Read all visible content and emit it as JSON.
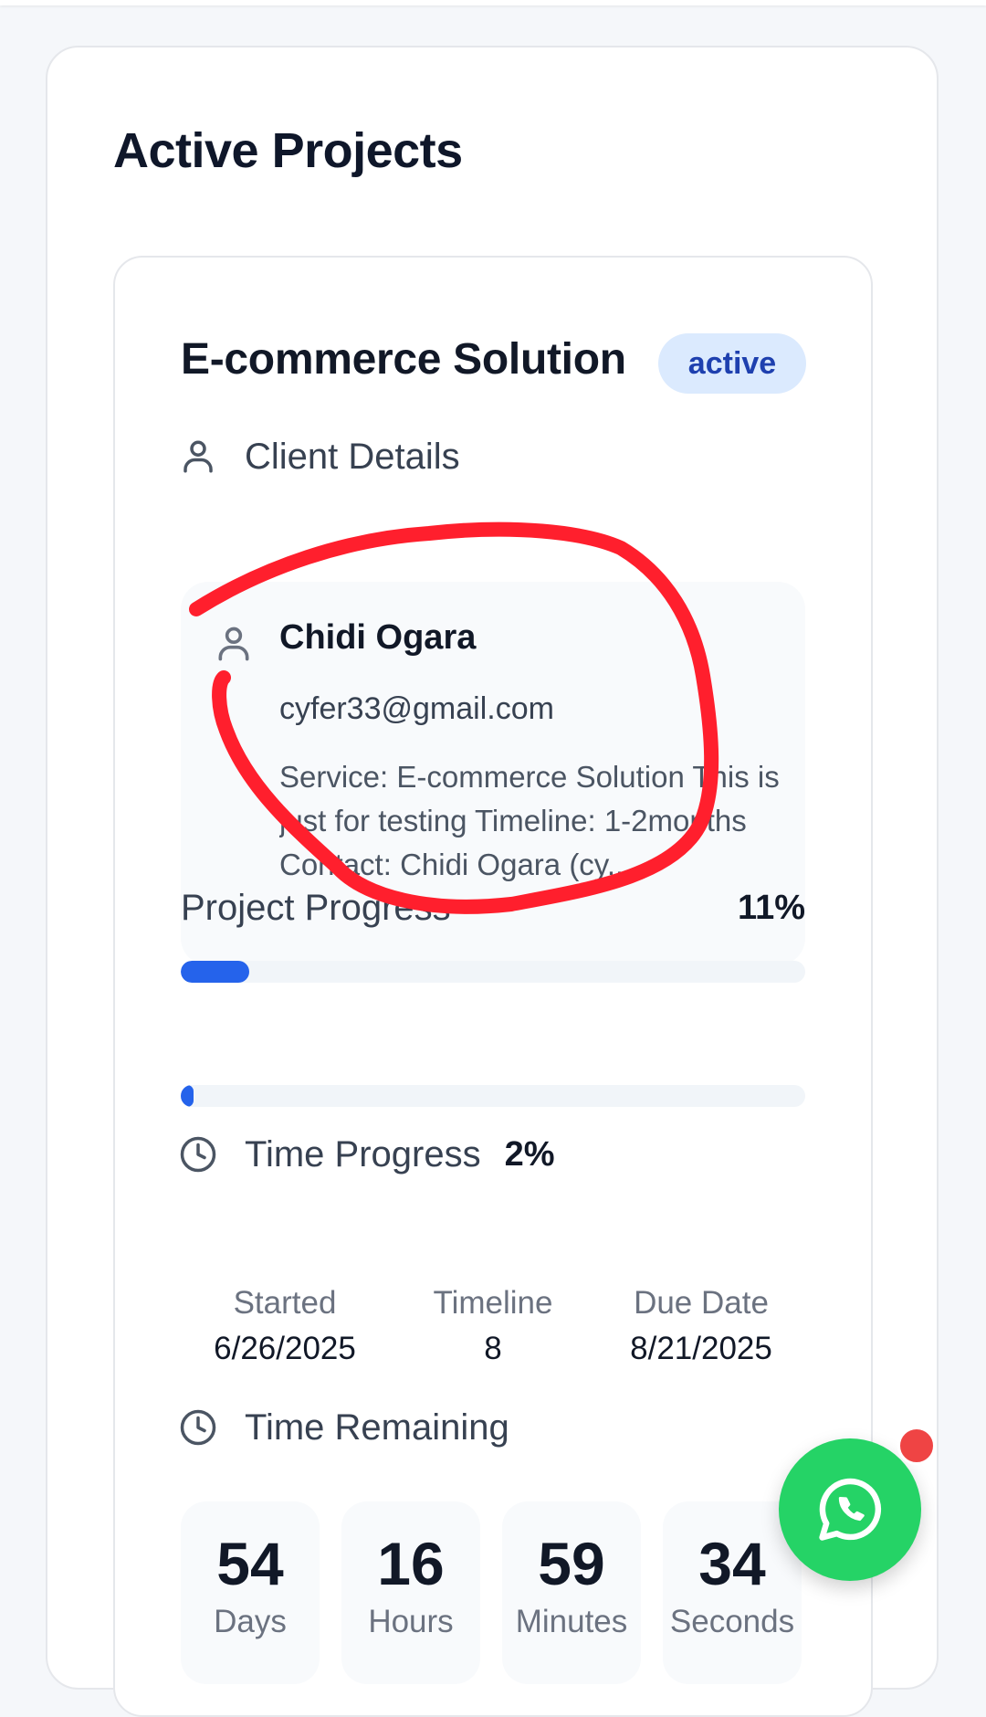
{
  "page": {
    "title": "Active Projects"
  },
  "project": {
    "title": "E-commerce Solution",
    "status": "active",
    "client_section_label": "Client Details",
    "client": {
      "name": "Chidi Ogara",
      "email": "cyfer33@gmail.com",
      "service": "Service: E-commerce Solution This is just for testing Timeline: 1-2months Contact: Chidi Ogara (cy..."
    },
    "project_progress": {
      "label": "Project Progress",
      "percent_text": "11%",
      "value": 0.11
    },
    "time_progress": {
      "label": "Time Progress",
      "percent_text": "2%",
      "value": 0.02
    },
    "dates": [
      {
        "label": "Started",
        "value": "6/26/2025"
      },
      {
        "label": "Timeline",
        "value": "8"
      },
      {
        "label": "Due Date",
        "value": "8/21/2025"
      }
    ],
    "time_remaining": {
      "label": "Time Remaining",
      "units": [
        {
          "value": "54",
          "unit": "Days"
        },
        {
          "value": "16",
          "unit": "Hours"
        },
        {
          "value": "59",
          "unit": "Minutes"
        },
        {
          "value": "34",
          "unit": "Seconds"
        }
      ]
    }
  },
  "colors": {
    "accent": "#2563eb",
    "badge_bg": "#dbeafe",
    "badge_text": "#1e40af",
    "whatsapp": "#25d366",
    "notification": "#ef4444",
    "annotation": "#ff1f2d"
  },
  "icons": {
    "client": "user-icon",
    "time": "clock-icon",
    "fab": "whatsapp-icon"
  }
}
